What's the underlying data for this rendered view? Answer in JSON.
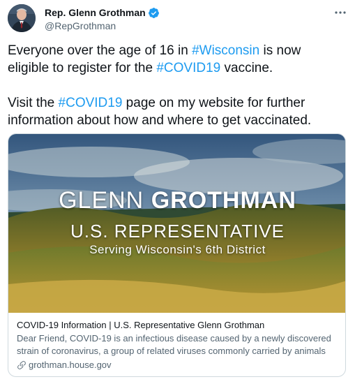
{
  "author": {
    "name": "Rep. Glenn Grothman",
    "handle": "@RepGrothman",
    "verified": true
  },
  "tweet": {
    "line1_prefix": "Everyone over the age of 16 in ",
    "line1_tag": "#Wisconsin",
    "line1_suffix": " is now",
    "line2_prefix": "eligible to register for the ",
    "line2_tag": "#COVID19",
    "line2_suffix": " vaccine.",
    "line3_prefix": "Visit the ",
    "line3_tag": "#COVID19",
    "line3_suffix": " page on my website for further",
    "line4": "information about how and where to get vaccinated."
  },
  "card": {
    "image_name_light": "GLENN ",
    "image_name_bold": "GROTHMAN",
    "image_role": "U.S. REPRESENTATIVE",
    "image_district": "Serving Wisconsin's 6th District",
    "title": "COVID-19 Information | U.S. Representative Glenn Grothman",
    "description": "Dear Friend, COVID-19 is an infectious disease caused by a newly discovered strain of coronavirus, a group of related viruses commonly carried by animals a...",
    "domain": "grothman.house.gov"
  },
  "colors": {
    "hashtag": "#1d9bf0",
    "verified_badge": "#1d9bf0",
    "secondary_text": "#536471"
  },
  "icons": [
    "verified-badge-icon",
    "more-options-icon",
    "link-icon"
  ]
}
